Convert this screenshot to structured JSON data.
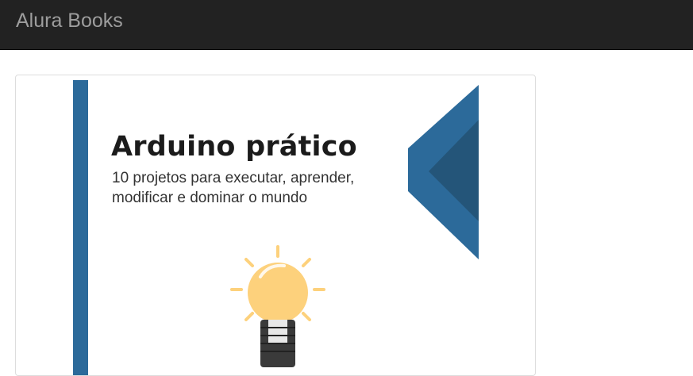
{
  "navbar": {
    "brand": "Alura Books"
  },
  "book": {
    "title": "Arduino prático",
    "subtitle_line1": "10 projetos para executar, aprender,",
    "subtitle_line2": "modificar e dominar o mundo"
  },
  "colors": {
    "navbar_bg": "#222222",
    "brand_text": "#9d9d9d",
    "cover_blue": "#2c6a9a",
    "cover_blue_dark": "#245579",
    "bulb": "#fdd17c"
  }
}
